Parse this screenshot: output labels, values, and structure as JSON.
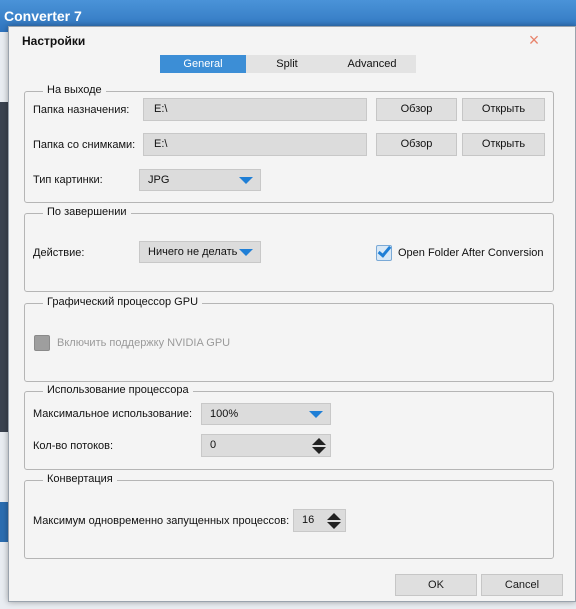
{
  "app": {
    "title": "Converter 7"
  },
  "dialog": {
    "title": "Настройки",
    "close_symbol": "×",
    "tabs": [
      {
        "label": "General",
        "active": true
      },
      {
        "label": "Split",
        "active": false
      },
      {
        "label": "Advanced",
        "active": false
      }
    ]
  },
  "output": {
    "group_title": "На выходе",
    "dest_label": "Папка назначения:",
    "dest_value": "E:\\",
    "snap_label": "Папка со снимками:",
    "snap_value": "E:\\",
    "browse_label": "Обзор",
    "open_label": "Открыть",
    "image_type_label": "Тип картинки:",
    "image_type_value": "JPG"
  },
  "completion": {
    "group_title": "По завершении",
    "action_label": "Действие:",
    "action_value": "Ничего не делать",
    "open_folder_label": "Open Folder After Conversion",
    "open_folder_checked": true
  },
  "gpu": {
    "group_title": "Графический процессор GPU",
    "nvidia_label": "Включить поддержку NVIDIA GPU",
    "nvidia_checked": false,
    "nvidia_disabled": true
  },
  "cpu": {
    "group_title": "Использование процессора",
    "max_usage_label": "Максимальное использование:",
    "max_usage_value": "100%",
    "threads_label": "Кол-во потоков:",
    "threads_value": "0"
  },
  "conversion": {
    "group_title": "Конвертация",
    "max_processes_label": "Максимум одновременно запущенных процессов:",
    "max_processes_value": "16"
  },
  "footer": {
    "ok_label": "OK",
    "cancel_label": "Cancel"
  },
  "colors": {
    "accent": "#3c8ed6",
    "arrow": "#1f7fd6",
    "close": "#e8836b"
  },
  "icons": {
    "close": "close-icon",
    "dropdown": "chevron-down-icon",
    "spin": "spinner-arrows-icon",
    "check": "checkmark-icon"
  }
}
